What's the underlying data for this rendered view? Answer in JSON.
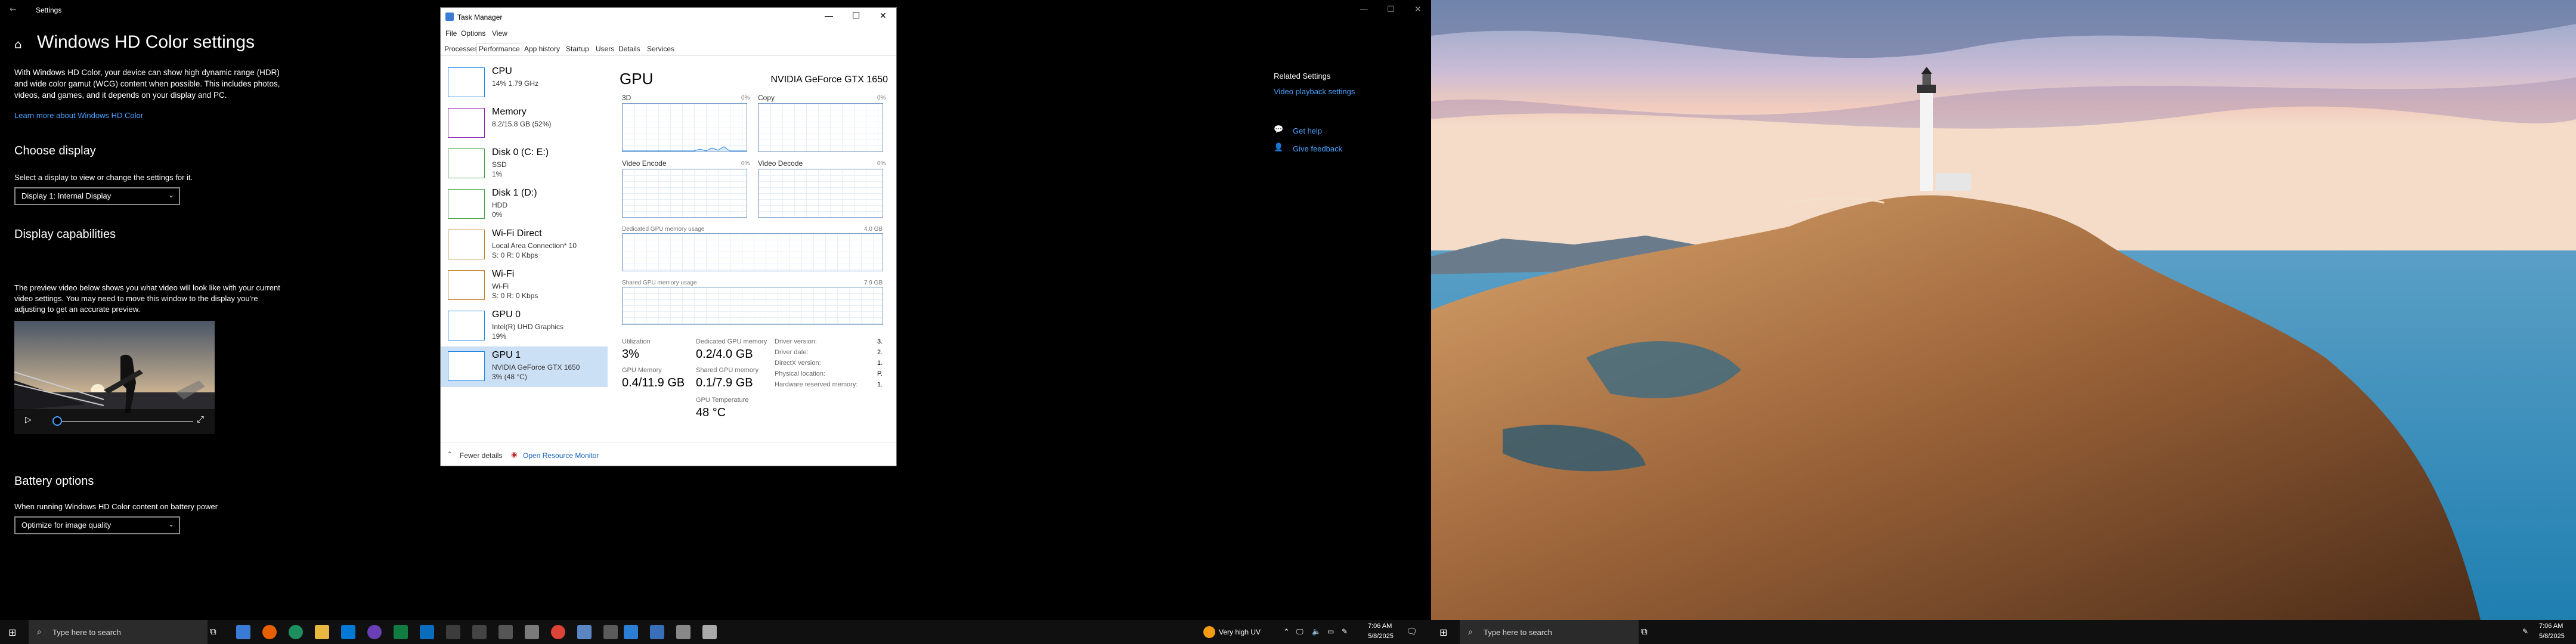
{
  "settings": {
    "window_title": "Settings",
    "page_title": "Windows HD Color settings",
    "description": "With Windows HD Color, your device can show high dynamic range (HDR) and wide color gamut (WCG) content when possible. This includes photos, videos, and games, and it depends on your display and PC.",
    "learn_more": "Learn more about Windows HD Color",
    "choose_display_heading": "Choose display",
    "choose_display_label": "Select a display to view or change the settings for it.",
    "display_selected": "Display 1: Internal Display",
    "capabilities_heading": "Display capabilities",
    "preview_text": "The preview video below shows you what video will look like with your current video settings. You may need to move this window to the display you're adjusting to get an accurate preview.",
    "battery_heading": "Battery options",
    "battery_label": "When running Windows HD Color content on battery power",
    "battery_selected": "Optimize for image quality",
    "related_heading": "Related Settings",
    "related_link": "Video playback settings",
    "get_help": "Get help",
    "give_feedback": "Give feedback"
  },
  "taskmgr": {
    "title": "Task Manager",
    "menu": [
      "File",
      "Options",
      "View"
    ],
    "tabs": [
      "Processes",
      "Performance",
      "App history",
      "Startup",
      "Users",
      "Details",
      "Services"
    ],
    "active_tab": "Performance",
    "side": [
      {
        "name": "CPU",
        "sub1": "14% 1.79 GHz",
        "sub2": "",
        "color": "#1e88e5"
      },
      {
        "name": "Memory",
        "sub1": "8.2/15.8 GB (52%)",
        "sub2": "",
        "color": "#8e24aa"
      },
      {
        "name": "Disk 0 (C: E:)",
        "sub1": "SSD",
        "sub2": "1%",
        "color": "#43a047"
      },
      {
        "name": "Disk 1 (D:)",
        "sub1": "HDD",
        "sub2": "0%",
        "color": "#43a047"
      },
      {
        "name": "Wi-Fi Direct",
        "sub1": "Local Area Connection* 10",
        "sub2": "S: 0 R: 0 Kbps",
        "color": "#c27c2c"
      },
      {
        "name": "Wi-Fi",
        "sub1": "Wi-Fi",
        "sub2": "S: 0 R: 0 Kbps",
        "color": "#c27c2c"
      },
      {
        "name": "GPU 0",
        "sub1": "Intel(R) UHD Graphics",
        "sub2": "19%",
        "color": "#1e88e5"
      },
      {
        "name": "GPU 1",
        "sub1": "NVIDIA GeForce GTX 1650",
        "sub2": "3% (48 °C)",
        "color": "#1e88e5"
      }
    ],
    "main": {
      "heading": "GPU",
      "gpu_name": "NVIDIA GeForce GTX 1650",
      "graphs": [
        {
          "label": "3D",
          "pct": "0%"
        },
        {
          "label": "Copy",
          "pct": "0%"
        },
        {
          "label": "Video Encode",
          "pct": "0%"
        },
        {
          "label": "Video Decode",
          "pct": "0%"
        }
      ],
      "dedicated_label": "Dedicated GPU memory usage",
      "dedicated_max": "4.0 GB",
      "shared_label": "Shared GPU memory usage",
      "shared_max": "7.9 GB",
      "stats": {
        "utilization_label": "Utilization",
        "utilization": "3%",
        "dedicated_mem_label": "Dedicated GPU memory",
        "dedicated_mem": "0.2/4.0 GB",
        "gpu_memory_label": "GPU Memory",
        "gpu_memory": "0.4/11.9 GB",
        "shared_mem_label": "Shared GPU memory",
        "shared_mem": "0.1/7.9 GB",
        "temp_label": "GPU Temperature",
        "temp": "48 °C",
        "driver_version": "Driver version:",
        "driver_date": "Driver date:",
        "directx": "DirectX version:",
        "physical": "Physical location:",
        "hw_reserved": "Hardware reserved memory:",
        "driver_version_v": "3.",
        "driver_date_v": "2.",
        "directx_v": "1.",
        "physical_v": "P.",
        "hw_reserved_v": "1."
      }
    },
    "fewer_details": "Fewer details",
    "open_resource_monitor": "Open Resource Monitor"
  },
  "taskbar": {
    "search_placeholder": "Type here to search",
    "weather": "Very high UV",
    "time": "7:06 AM",
    "date": "5/8/2025"
  }
}
